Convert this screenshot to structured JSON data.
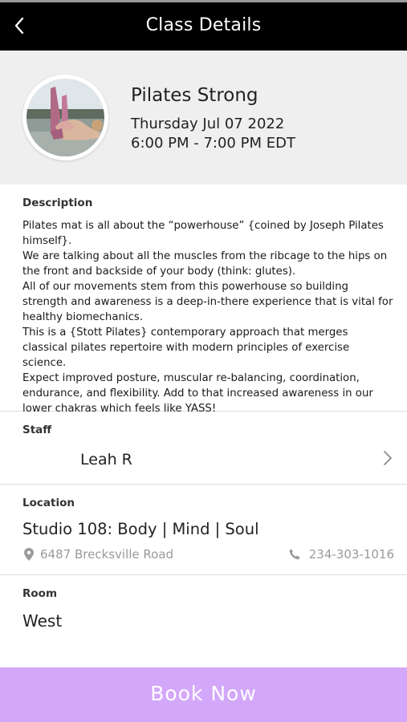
{
  "header": {
    "title": "Class Details",
    "back_icon": "chevron-left-icon"
  },
  "class": {
    "name": "Pilates Strong",
    "date": "Thursday Jul 07 2022",
    "time": "6:00 PM - 7:00 PM EDT"
  },
  "description": {
    "label": "Description",
    "paragraphs": [
      "Pilates mat is all about the “powerhouse” {coined by Joseph Pilates himself}.",
      "We are talking about  all the muscles from the ribcage to the hips on the front and backside of your body (think: glutes).",
      "All of our movements stem from this powerhouse so building strength and awareness is a deep-in-there experience that is vital for healthy biomechanics.",
      "This is a {Stott Pilates} contemporary approach that merges classical pilates repertoire with modern principles of exercise science.",
      "Expect improved posture, muscular re-balancing, coordination, endurance, and flexibility. Add to that increased awareness in our lower chakras which feels like YASS!"
    ]
  },
  "staff": {
    "label": "Staff",
    "name": "Leah R",
    "chevron_icon": "chevron-right-icon"
  },
  "location": {
    "label": "Location",
    "studio": "Studio 108: Body | Mind | Soul",
    "address": "6487 Brecksville Road",
    "phone": "234-303-1016",
    "address_icon": "map-pin-icon",
    "phone_icon": "phone-icon"
  },
  "room": {
    "label": "Room",
    "name": "West"
  },
  "book_button": {
    "label": "Book Now"
  },
  "colors": {
    "topbar": "#000000",
    "header_bg": "#efefef",
    "book_button": "#d3a8fa",
    "muted_text": "#9a9a9a"
  }
}
